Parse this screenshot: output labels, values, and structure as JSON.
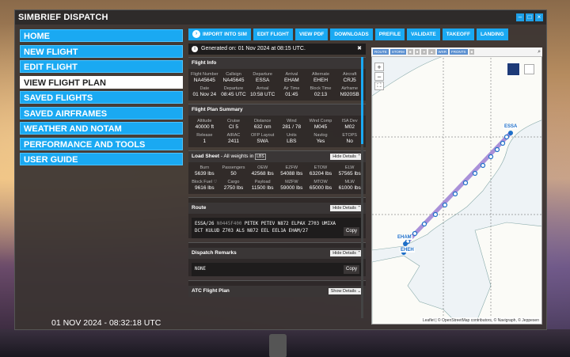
{
  "window": {
    "title": "SIMBRIEF DISPATCH",
    "btn_min": "–",
    "btn_max": "□",
    "btn_close": "×"
  },
  "nav": [
    "HOME",
    "NEW FLIGHT",
    "EDIT FLIGHT",
    "VIEW FLIGHT PLAN",
    "SAVED FLIGHTS",
    "SAVED AIRFRAMES",
    "WEATHER AND NOTAM",
    "PERFORMANCE AND TOOLS",
    "USER GUIDE"
  ],
  "clock": "01 NOV 2024 - 08:32:18 UTC",
  "toolbar": {
    "import": "IMPORT INTO SIM",
    "edit": "EDIT FLIGHT",
    "pdf": "VIEW PDF",
    "downloads": "DOWNLOADS",
    "prefile": "PREFILE",
    "validate": "VALIDATE",
    "takeoff": "TAKEOFF",
    "landing": "LANDING"
  },
  "notice": "Generated on: 01 Nov 2024 at 08:15 UTC.",
  "flight_info": {
    "title": "Flight Info",
    "row1": [
      {
        "l": "Flight Number",
        "v": "NA45645"
      },
      {
        "l": "Callsign",
        "v": "NA45645"
      },
      {
        "l": "Departure",
        "v": "ESSA"
      },
      {
        "l": "Arrival",
        "v": "EHAM"
      },
      {
        "l": "Alternate",
        "v": "EHEH"
      },
      {
        "l": "Aircraft",
        "v": "CRJ5"
      }
    ],
    "row2": [
      {
        "l": "Date",
        "v": "01 Nov 24"
      },
      {
        "l": "Departure",
        "v": "08:45 UTC"
      },
      {
        "l": "Arrival",
        "v": "10:58 UTC"
      },
      {
        "l": "Air Time",
        "v": "01:45"
      },
      {
        "l": "Block Time",
        "v": "02:13"
      },
      {
        "l": "Airframe",
        "v": "N920SB"
      }
    ]
  },
  "summary": {
    "title": "Flight Plan Summary",
    "row1": [
      {
        "l": "Altitude",
        "v": "40000 ft"
      },
      {
        "l": "Cruise",
        "v": "CI 5"
      },
      {
        "l": "Distance",
        "v": "632 nm"
      },
      {
        "l": "Wind",
        "v": "281 / 78"
      },
      {
        "l": "Wind Comp",
        "v": "M045"
      },
      {
        "l": "ISA Dev",
        "v": "M02"
      }
    ],
    "row2": [
      {
        "l": "Release",
        "v": "1"
      },
      {
        "l": "AIRAC",
        "v": "2411"
      },
      {
        "l": "OFP Layout",
        "v": "SWA"
      },
      {
        "l": "Units",
        "v": "LBS"
      },
      {
        "l": "Navlog",
        "v": "Yes"
      },
      {
        "l": "ETOPS",
        "v": "No"
      }
    ]
  },
  "loadsheet": {
    "title": "Load Sheet",
    "subtitle": "- All weights in",
    "unit": "LBS",
    "hide": "Hide Details",
    "row1": [
      {
        "l": "Burn",
        "v": "5639 lbs"
      },
      {
        "l": "Passengers",
        "v": "50"
      },
      {
        "l": "OEW",
        "v": "42568 lbs"
      },
      {
        "l": "EZFW",
        "v": "54088 lbs"
      },
      {
        "l": "ETOW",
        "v": "63204 lbs"
      },
      {
        "l": "ELW",
        "v": "57565 lbs"
      }
    ],
    "row2": [
      {
        "l": "Block Fuel",
        "v": "9616 lbs"
      },
      {
        "l": "Cargo",
        "v": "2750 lbs"
      },
      {
        "l": "Payload",
        "v": "11500 lbs"
      },
      {
        "l": "MZFW",
        "v": "59000 lbs"
      },
      {
        "l": "MTOW",
        "v": "65000 lbs"
      },
      {
        "l": "MLW",
        "v": "61000 lbs"
      }
    ]
  },
  "route": {
    "title": "Route",
    "hide": "Hide Details",
    "line1a": "ESSA/26 ",
    "line1b": "N0445F400",
    "line1c": " PETEK PETEV N872 ELPAX Z703 UMIXA",
    "line2": "DCT KULUD Z703 ALS N872 EEL EEL1A EHAM/27",
    "copy": "Copy"
  },
  "remarks": {
    "title": "Dispatch Remarks",
    "hide": "Hide Details",
    "text": "NONE",
    "copy": "Copy"
  },
  "atc": {
    "title": "ATC Flight Plan",
    "show": "Show Details"
  },
  "map": {
    "chips": [
      "ROUTE",
      "STORM",
      "",
      "",
      "",
      "",
      "WXR",
      "FRONTS",
      ""
    ],
    "labels": [
      "ESSA",
      "EHAM",
      "EHEH"
    ],
    "attribution": "Leaflet | © OpenStreetMap contributors, © Navigraph, © Jeppesen",
    "zoom_in": "+",
    "zoom_out": "−",
    "fullscreen": "⛶"
  },
  "colors": {
    "accent": "#1aa9f2",
    "route": "#9b7fd4",
    "waypoint": "#1e6fc8"
  }
}
